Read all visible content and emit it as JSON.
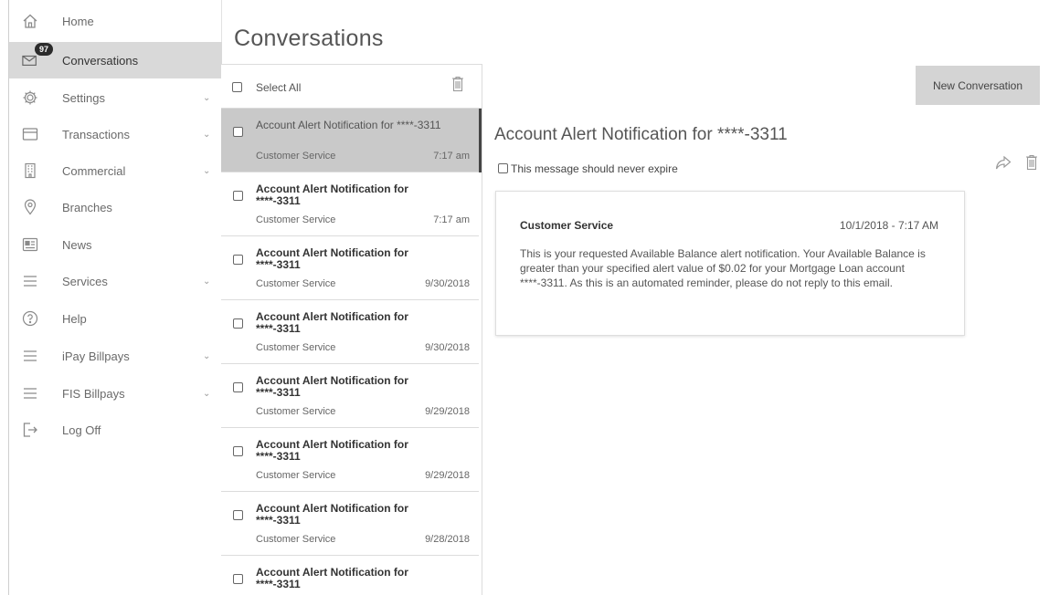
{
  "sidebar": {
    "items": [
      {
        "label": "Home",
        "icon": "home-icon"
      },
      {
        "label": "Conversations",
        "icon": "envelope-icon",
        "badge": "97",
        "active": true
      },
      {
        "label": "Settings",
        "icon": "gear-icon",
        "expandable": true
      },
      {
        "label": "Transactions",
        "icon": "card-icon",
        "expandable": true
      },
      {
        "label": "Commercial",
        "icon": "building-icon",
        "expandable": true
      },
      {
        "label": "Branches",
        "icon": "map-pin-icon"
      },
      {
        "label": "News",
        "icon": "newspaper-icon"
      },
      {
        "label": "Services",
        "icon": "menu-icon",
        "expandable": true
      },
      {
        "label": "Help",
        "icon": "help-icon"
      },
      {
        "label": "iPay Billpays",
        "icon": "menu-icon",
        "expandable": true
      },
      {
        "label": "FIS Billpays",
        "icon": "menu-icon",
        "expandable": true
      },
      {
        "label": "Log Off",
        "icon": "logout-icon"
      }
    ]
  },
  "page": {
    "title": "Conversations"
  },
  "list": {
    "select_all_label": "Select All",
    "messages": [
      {
        "subject": "Account Alert Notification for ****-3311",
        "sender": "Customer Service",
        "date": "7:17 am",
        "selected": true
      },
      {
        "subject": "Account Alert Notification for ****-3311",
        "sender": "Customer Service",
        "date": "7:17 am"
      },
      {
        "subject": "Account Alert Notification for ****-3311",
        "sender": "Customer Service",
        "date": "9/30/2018"
      },
      {
        "subject": "Account Alert Notification for ****-3311",
        "sender": "Customer Service",
        "date": "9/30/2018"
      },
      {
        "subject": "Account Alert Notification for ****-3311",
        "sender": "Customer Service",
        "date": "9/29/2018"
      },
      {
        "subject": "Account Alert Notification for ****-3311",
        "sender": "Customer Service",
        "date": "9/29/2018"
      },
      {
        "subject": "Account Alert Notification for ****-3311",
        "sender": "Customer Service",
        "date": "9/28/2018"
      },
      {
        "subject": "Account Alert Notification for ****-3311",
        "sender": "",
        "date": ""
      }
    ]
  },
  "detail": {
    "new_conversation_label": "New Conversation",
    "title": "Account Alert Notification for ****-3311",
    "expire_label": "This message should never expire",
    "card": {
      "sender": "Customer Service",
      "date": "10/1/2018 - 7:17 AM",
      "body": "This is your requested Available Balance alert notification. Your Available Balance is greater than your specified alert value of $0.02 for your Mortgage Loan account ****-3311. As this is an automated reminder, please do not reply to this email."
    }
  }
}
